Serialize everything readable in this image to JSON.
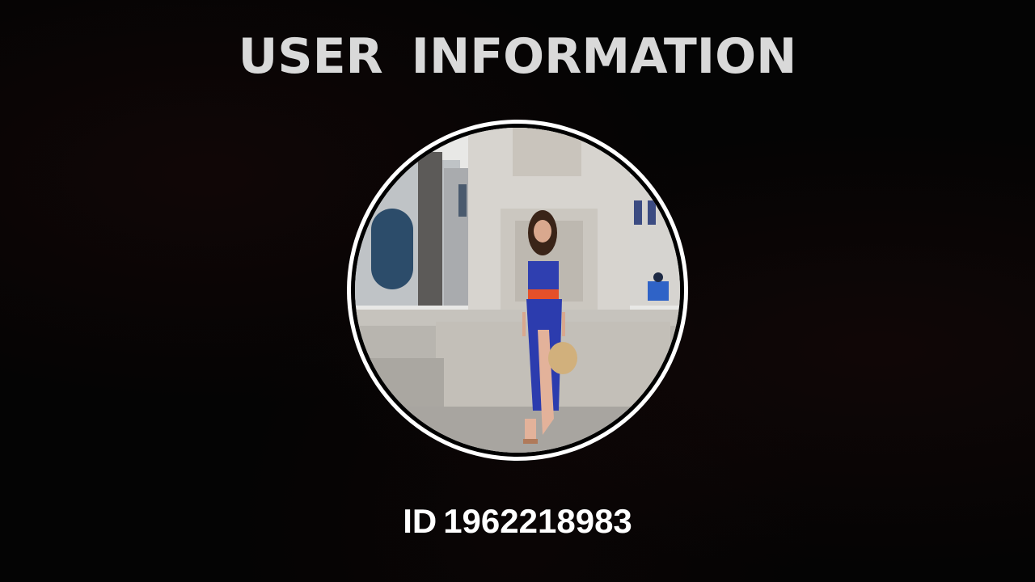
{
  "header": {
    "title": "USER  INFORMATION"
  },
  "profile": {
    "avatar_icon": "user-photo",
    "id_label": "ID",
    "id_value": "1962218983"
  },
  "colors": {
    "background": "#040404",
    "title": "#d9d9d9",
    "ring": "#ffffff",
    "id_text": "#ffffff"
  }
}
